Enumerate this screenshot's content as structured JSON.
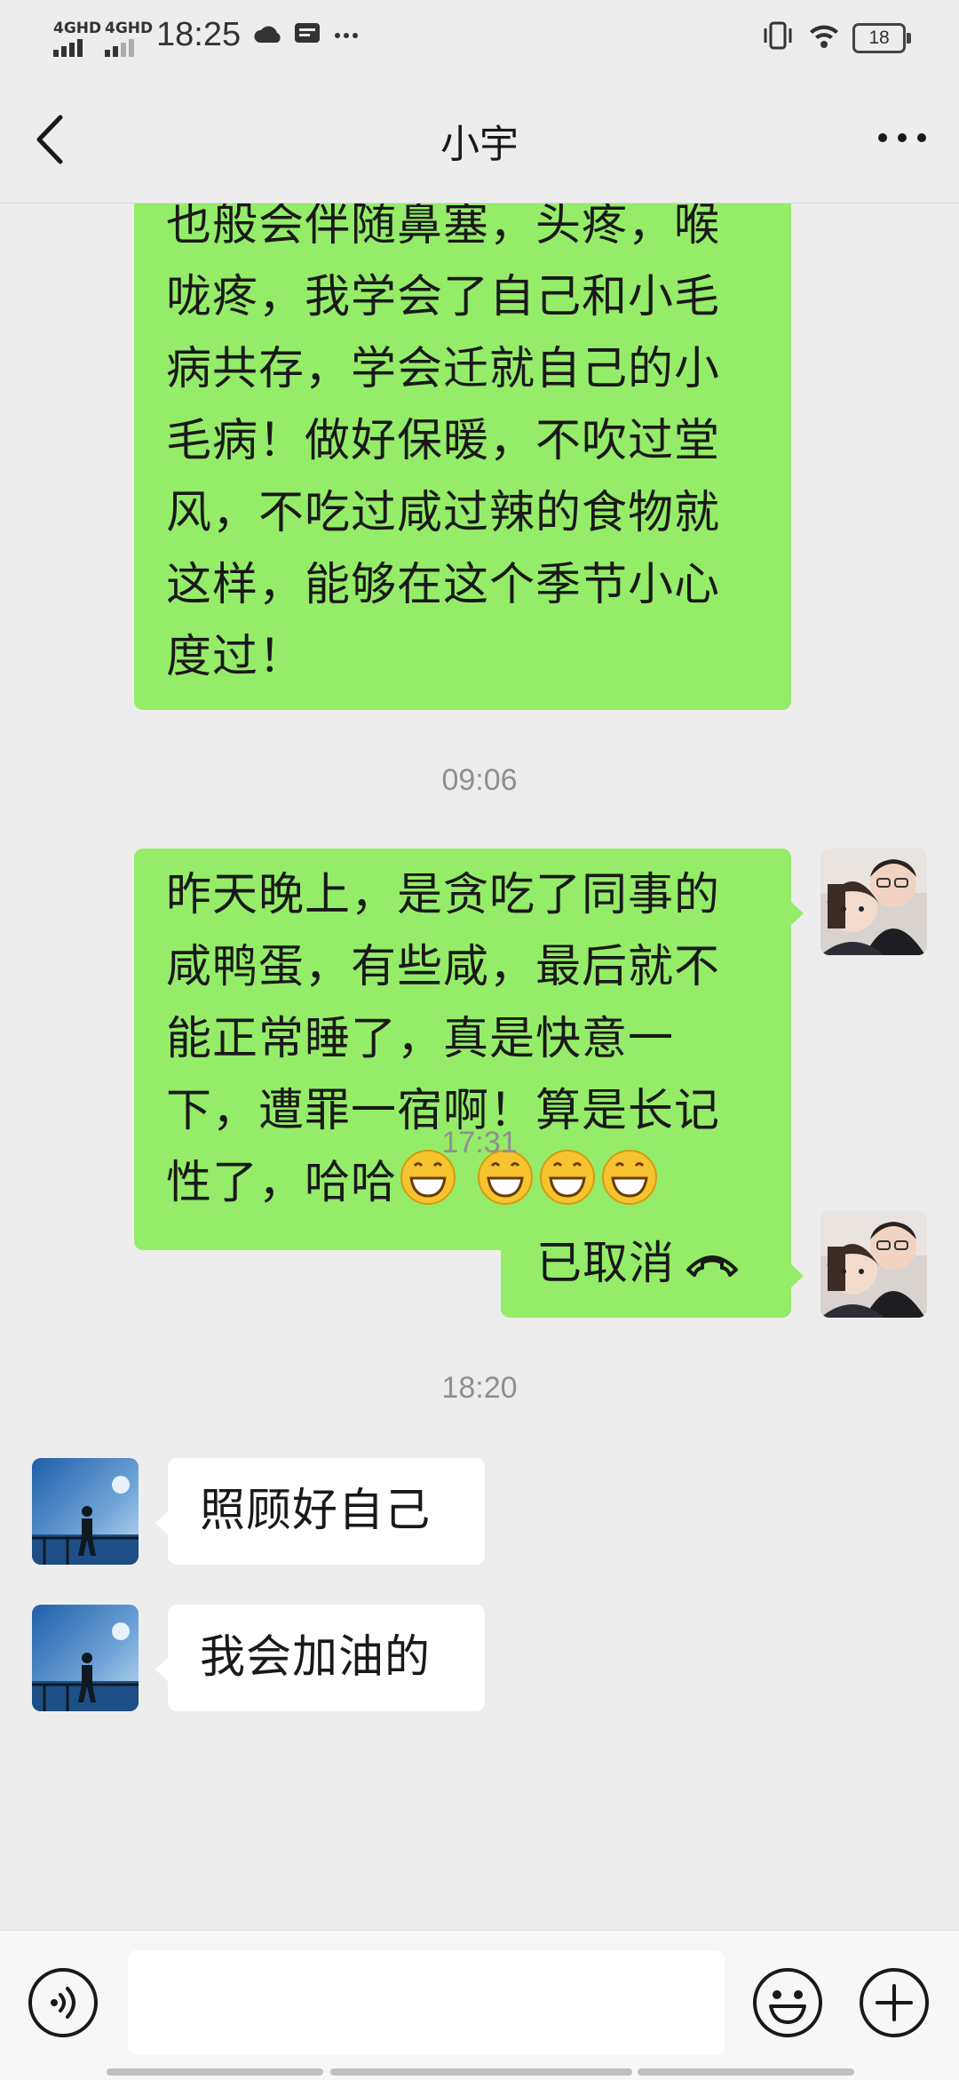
{
  "status_bar": {
    "net1": "4GHD",
    "net2": "4GHD",
    "time": "18:25",
    "battery": "18"
  },
  "nav": {
    "title": "小宇"
  },
  "messages": {
    "m1_text": "也般会伴随鼻塞，头疼，喉咙疼，我学会了自己和小毛病共存，学会迁就自己的小毛病！做好保暖，不吹过堂风，不吃过咸过辣的食物就这样，能够在这个季节小心度过！",
    "ts1": "09:06",
    "m2_text": "昨天晚上，是贪吃了同事的咸鸭蛋，有些咸，最后就不能正常睡了，真是快意一下，遭罪一宿啊！算是长记性了，哈哈",
    "ts2": "17:31",
    "m3_text": "已取消",
    "ts3": "18:20",
    "m4_text": "照顾好自己",
    "m5_text": "我会加油的"
  },
  "input": {
    "placeholder": ""
  }
}
